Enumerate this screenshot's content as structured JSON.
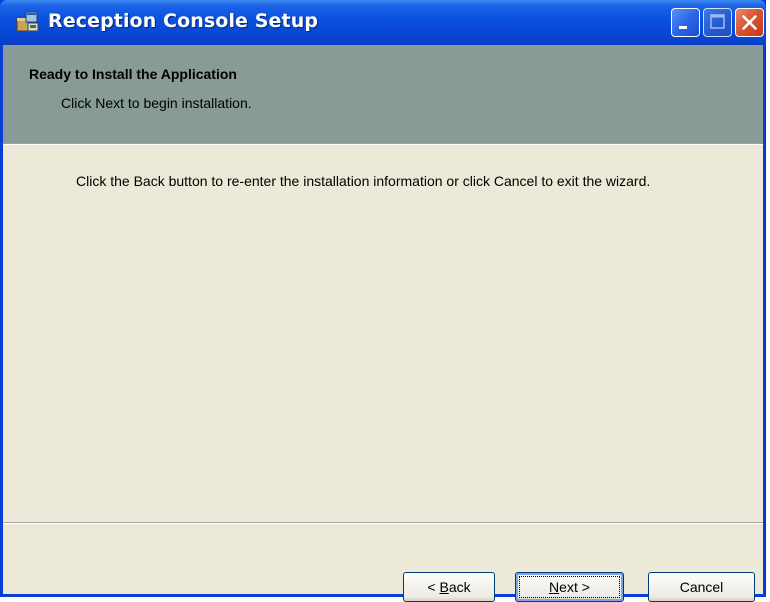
{
  "window": {
    "title": "Reception Console Setup",
    "icon": "installer-package-icon"
  },
  "titlebar_buttons": {
    "minimize": "minimize-icon",
    "maximize": "maximize-icon",
    "close": "close-icon"
  },
  "banner": {
    "title": "Ready to Install the Application",
    "subtitle": "Click Next to begin installation."
  },
  "body": {
    "text": "Click the Back button to re-enter the installation information or click Cancel to exit the wizard."
  },
  "buttons": {
    "back": {
      "prefix": "< ",
      "mnemonic": "B",
      "rest": "ack"
    },
    "next": {
      "mnemonic": "N",
      "rest": "ext",
      "suffix": " >"
    },
    "cancel": "Cancel"
  },
  "colors": {
    "titlebar": "#0a52e0",
    "banner": "#899b97",
    "dialog_face": "#ece9d8",
    "close_button": "#d9512c"
  }
}
